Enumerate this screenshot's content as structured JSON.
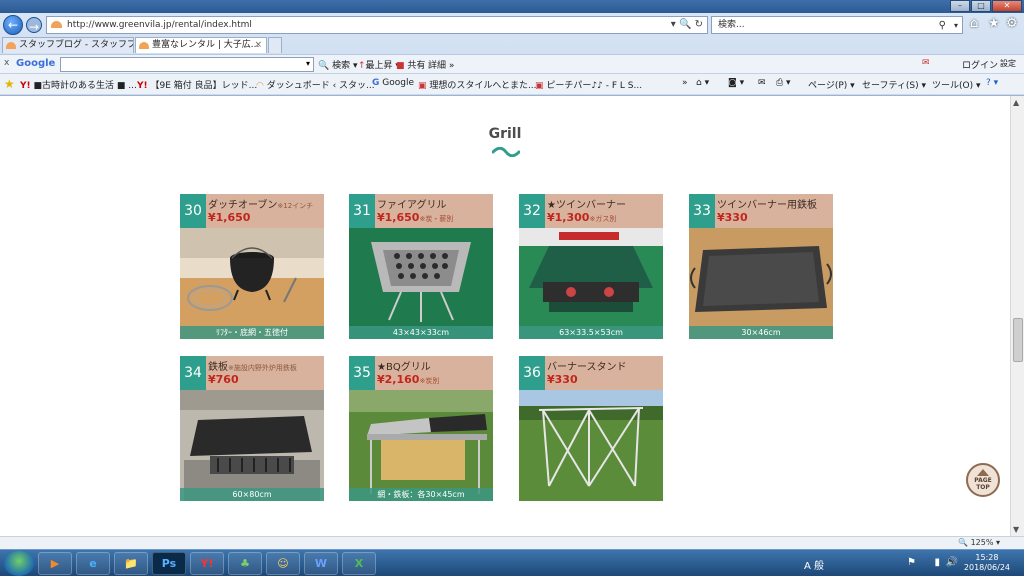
{
  "browser": {
    "window_buttons": [
      "–",
      "□",
      "✕"
    ],
    "address": "http://www.greenvila.jp/rental/index.html",
    "search_placeholder": "検索...",
    "tabs": [
      {
        "label": "スタッフブログ - スタッフブ..."
      },
      {
        "label": "豊富なレンタル | 大子広...",
        "close": "×"
      }
    ],
    "google_bar": {
      "close": "x",
      "logo": "Google",
      "search_label": "検索",
      "rank_label": "最上昇",
      "share_label": "共有",
      "detail_label": "詳細 »",
      "login_label": "ログイン",
      "settings_label": "設定"
    },
    "favorites": [
      "■古時計のある生活 ■ ...",
      "【9E 箱付 良品】レッド...",
      "ダッシュボード ‹ スタッ...",
      "Google",
      "理想のスタイルへとまた...",
      "ピーチパー♪♪ - F L S..."
    ],
    "command_bar": [
      "ページ(P)",
      "セーフティ(S)",
      "ツール(O)"
    ],
    "zoom": "125%"
  },
  "page": {
    "heading": "Grill",
    "page_top_label_1": "PAGE",
    "page_top_label_2": "TOP",
    "items": [
      {
        "number": "30",
        "name": "ダッチオーブン",
        "name_note": "※12インチ",
        "price": "¥1,650",
        "price_note": "",
        "caption": "ﾘﾌﾀｰ・底網・五徳付"
      },
      {
        "number": "31",
        "name": "ファイアグリル",
        "name_note": "",
        "price": "¥1,650",
        "price_note": "※炭・薪別",
        "caption": "43×43×33cm"
      },
      {
        "number": "32",
        "name": "★ツインバーナー",
        "name_note": "",
        "price": "¥1,300",
        "price_note": "※ガス別",
        "caption": "63×33.5×53cm"
      },
      {
        "number": "33",
        "name": "ツインバーナー用鉄板",
        "name_note": "",
        "price": "¥330",
        "price_note": "",
        "caption": "30×46cm"
      },
      {
        "number": "34",
        "name": "鉄板",
        "name_note": "※施設内野外炉用鉄板",
        "price": "¥760",
        "price_note": "",
        "caption": "60×80cm"
      },
      {
        "number": "35",
        "name": "★BQグリル",
        "name_note": "",
        "price": "¥2,160",
        "price_note": "※炭別",
        "caption": "網・鉄板：各30×45cm"
      },
      {
        "number": "36",
        "name": "バーナースタンド",
        "name_note": "",
        "price": "¥330",
        "price_note": "",
        "caption": ""
      }
    ]
  },
  "taskbar": {
    "apps": [
      "▶",
      "e",
      "📁",
      "Ps",
      "Y!",
      "♣",
      "☺",
      "W",
      "X"
    ],
    "ime": "A 般",
    "time": "15:28",
    "date": "2018/06/24"
  },
  "colors": {
    "card_bg": "#d9b29d",
    "number_bg": "#2e9f8c",
    "price": "#c0261c",
    "caption_bg": "#3c9682"
  }
}
